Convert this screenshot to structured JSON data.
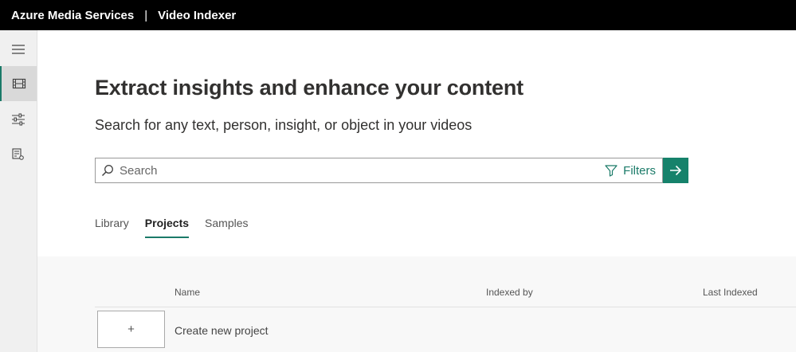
{
  "header": {
    "brand": "Azure Media Services",
    "separator": "|",
    "product": "Video Indexer"
  },
  "rail": {
    "items": [
      {
        "name": "menu-icon",
        "active": false
      },
      {
        "name": "film-icon",
        "active": true
      },
      {
        "name": "sliders-icon",
        "active": false
      },
      {
        "name": "settings-doc-icon",
        "active": false
      }
    ]
  },
  "main": {
    "title": "Extract insights and enhance your content",
    "subtitle": "Search for any text, person, insight, or object in your videos",
    "search": {
      "placeholder": "Search",
      "value": "",
      "filters_label": "Filters"
    },
    "tabs": [
      {
        "label": "Library",
        "active": false
      },
      {
        "label": "Projects",
        "active": true
      },
      {
        "label": "Samples",
        "active": false
      }
    ],
    "table": {
      "columns": [
        "Name",
        "Indexed by",
        "Last Indexed"
      ],
      "new_item": {
        "icon": "+",
        "label": "Create new project"
      }
    }
  },
  "colors": {
    "accent": "#16826b",
    "topbar": "#000000"
  }
}
